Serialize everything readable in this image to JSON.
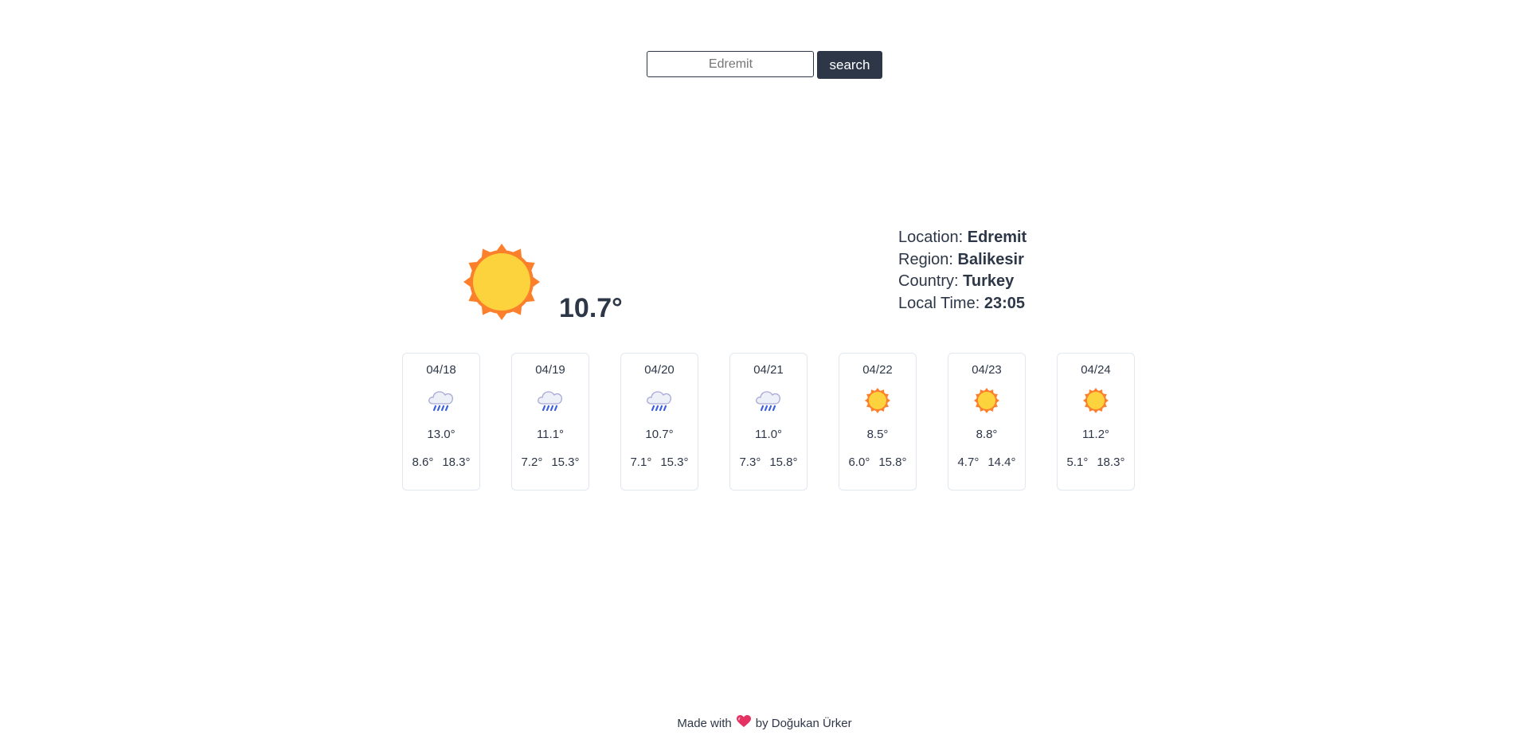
{
  "search": {
    "placeholder": "Edremit",
    "button_label": "search"
  },
  "current": {
    "icon": "sun-icon",
    "temperature": "10.7°"
  },
  "location": {
    "location_label": "Location: ",
    "location_value": "Edremit",
    "region_label": "Region: ",
    "region_value": "Balikesir",
    "country_label": "Country: ",
    "country_value": "Turkey",
    "time_label": "Local Time: ",
    "time_value": "23:05"
  },
  "forecast": [
    {
      "date": "04/18",
      "icon": "rain-cloud-icon",
      "avg": "13.0°",
      "min": "8.6°",
      "max": "18.3°"
    },
    {
      "date": "04/19",
      "icon": "rain-cloud-icon",
      "avg": "11.1°",
      "min": "7.2°",
      "max": "15.3°"
    },
    {
      "date": "04/20",
      "icon": "rain-cloud-icon",
      "avg": "10.7°",
      "min": "7.1°",
      "max": "15.3°"
    },
    {
      "date": "04/21",
      "icon": "rain-cloud-icon",
      "avg": "11.0°",
      "min": "7.3°",
      "max": "15.8°"
    },
    {
      "date": "04/22",
      "icon": "sun-icon",
      "avg": "8.5°",
      "min": "6.0°",
      "max": "15.8°"
    },
    {
      "date": "04/23",
      "icon": "sun-icon",
      "avg": "8.8°",
      "min": "4.7°",
      "max": "14.4°"
    },
    {
      "date": "04/24",
      "icon": "sun-icon",
      "avg": "11.2°",
      "min": "5.1°",
      "max": "18.3°"
    }
  ],
  "footer": {
    "prefix": "Made with",
    "icon": "heart-icon",
    "suffix": "by Doğukan Ürker"
  },
  "colors": {
    "primary": "#2d3748",
    "sun_inner": "#fdd33d",
    "sun_outer": "#fc7f2b",
    "rain": "#3b5fe0",
    "heart": "#e53262"
  }
}
